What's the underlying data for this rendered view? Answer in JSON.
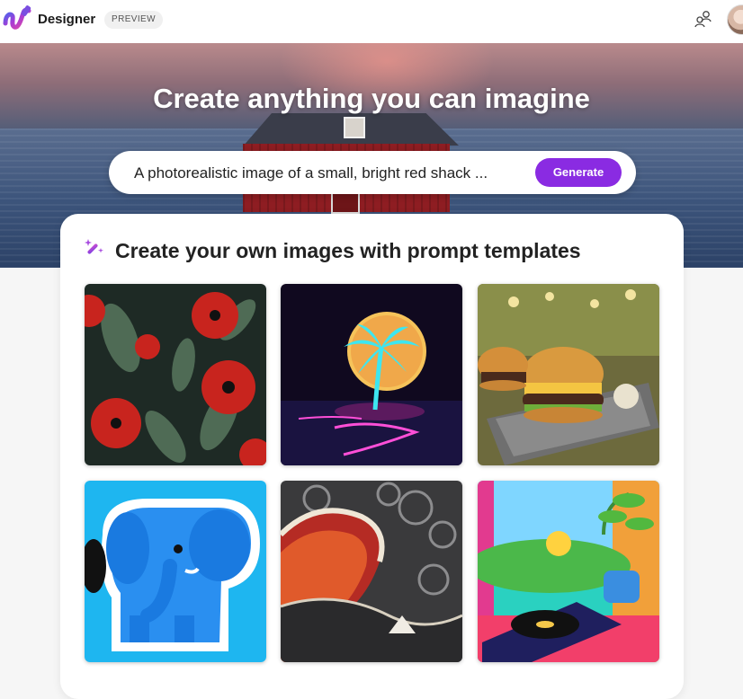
{
  "header": {
    "brand": "Designer",
    "badge": "PREVIEW",
    "icons": [
      "designer-logo-icon",
      "people-icon",
      "avatar"
    ]
  },
  "hero": {
    "title": "Create anything you can imagine",
    "prompt_text": "A photorealistic image of a small, bright red shack ...",
    "generate_label": "Generate",
    "accent_color": "#8a2be2"
  },
  "templates": {
    "title": "Create your own images with prompt templates",
    "tiles": [
      {
        "subject": "red poppies pattern"
      },
      {
        "subject": "neon palm tree island"
      },
      {
        "subject": "burgers on tray"
      },
      {
        "subject": "blue elephant sticker"
      },
      {
        "subject": "great wave paper art"
      },
      {
        "subject": "retro record player room"
      }
    ]
  }
}
